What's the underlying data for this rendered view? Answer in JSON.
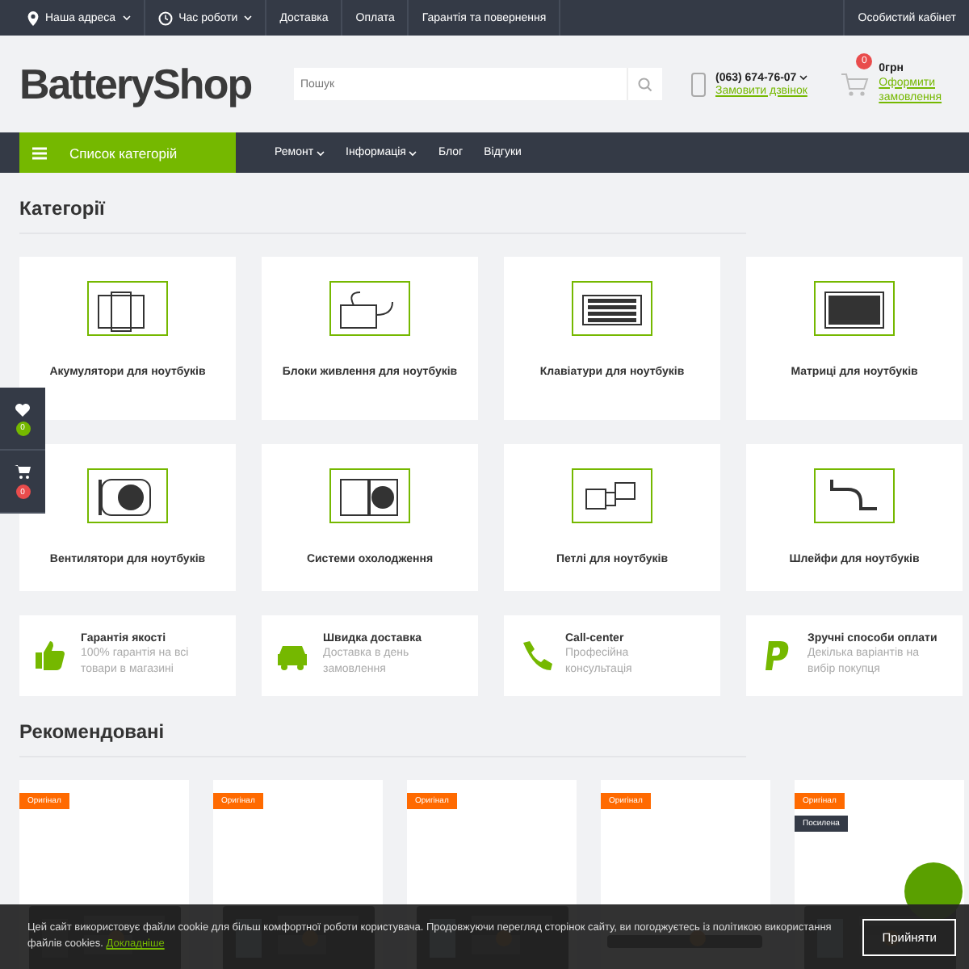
{
  "topbar": {
    "left": [
      {
        "label": "Наша адреса",
        "caret": true
      },
      {
        "label": "Час роботи",
        "caret": true
      },
      {
        "label": "Доставка",
        "caret": false
      },
      {
        "label": "Оплата",
        "caret": false
      },
      {
        "label": "Гарантія та повернення",
        "caret": false
      }
    ],
    "right": "Особистий кабінет"
  },
  "header": {
    "logo": "BatteryShop",
    "search": {
      "placeholder": "Пошук"
    },
    "phone": "(063) 674-76-07",
    "callback": "Замовити дзвінок",
    "cart": {
      "count": "0",
      "total": "0грн",
      "checkout": "Оформити замовлення"
    }
  },
  "nav": {
    "catalog": "Список категорій",
    "items": [
      {
        "label": "Ремонт",
        "caret": true
      },
      {
        "label": "Інформація",
        "caret": true
      },
      {
        "label": "Блог",
        "caret": false
      },
      {
        "label": "Відгуки",
        "caret": false
      }
    ]
  },
  "categories": {
    "title": "Категорії",
    "items": [
      "Акумулятори для ноутбуків",
      "Блоки живлення для ноутбуків",
      "Клавіатури для ноутбуків",
      "Матриці для ноутбуків",
      "Вентилятори для ноутбуків",
      "Системи охолодження",
      "Петлі для ноутбуків",
      "Шлейфи для ноутбуків"
    ]
  },
  "features": [
    {
      "title": "Гарантія якості",
      "text": "100% гарантія на всі товари в магазині"
    },
    {
      "title": "Швидка доставка",
      "text": "Доставка в день замовлення"
    },
    {
      "title": "Call-center",
      "text": "Професійна консультація"
    },
    {
      "title": "Зручні способи оплати",
      "text": "Декілька варіантів на вибір покупця"
    }
  ],
  "recommended": {
    "title": "Рекомендовані",
    "products": [
      {
        "badges": [
          {
            "label": "Оригінал",
            "kind": "original"
          }
        ]
      },
      {
        "badges": [
          {
            "label": "Оригінал",
            "kind": "original"
          }
        ]
      },
      {
        "badges": [
          {
            "label": "Оригінал",
            "kind": "original"
          }
        ]
      },
      {
        "badges": [
          {
            "label": "Оригінал",
            "kind": "original"
          }
        ]
      },
      {
        "badges": [
          {
            "label": "Оригінал",
            "kind": "original"
          },
          {
            "label": "Посилена",
            "kind": "boosted"
          }
        ]
      }
    ]
  },
  "sidepanel": {
    "wishlist_count": "0",
    "cart_count": "0"
  },
  "cookie": {
    "text": "Цей сайт використовує файли cookie для більш комфортної роботи користувача. Продовжуючи перегляд сторінок сайту, ви погоджуєтесь із політикою використання файлів cookies.",
    "link": "Докладніше",
    "button": "Прийняти"
  }
}
